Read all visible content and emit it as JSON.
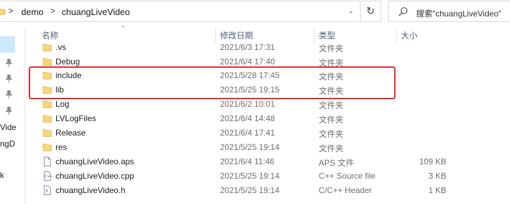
{
  "breadcrumb": {
    "items": [
      "demo",
      "chuangLiveVideo"
    ],
    "separator": ">"
  },
  "search": {
    "placeholder": "搜索\"chuangLiveVideo\""
  },
  "icons": {
    "refresh": "refresh-icon",
    "search": "search-icon",
    "dropdown": "chevron-down-icon",
    "pin": "pin-icon",
    "folder": "folder-icon"
  },
  "nav": {
    "fragments": [
      "Vide",
      "ngD",
      "k"
    ]
  },
  "columns": {
    "name": "名称",
    "date": "修改日期",
    "type": "类型",
    "size": "大小"
  },
  "rows": [
    {
      "name": ".vs",
      "date": "2021/6/3 17:31",
      "type": "文件夹",
      "size": "",
      "icon": "folder"
    },
    {
      "name": "Debug",
      "date": "2021/6/4 17:40",
      "type": "文件夹",
      "size": "",
      "icon": "folder"
    },
    {
      "name": "include",
      "date": "2021/5/28 17:45",
      "type": "文件夹",
      "size": "",
      "icon": "folder"
    },
    {
      "name": "lib",
      "date": "2021/5/25 19:15",
      "type": "文件夹",
      "size": "",
      "icon": "folder"
    },
    {
      "name": "Log",
      "date": "2021/6/2 10:01",
      "type": "文件夹",
      "size": "",
      "icon": "folder"
    },
    {
      "name": "LVLogFiles",
      "date": "2021/6/4 14:48",
      "type": "文件夹",
      "size": "",
      "icon": "folder"
    },
    {
      "name": "Release",
      "date": "2021/6/4 17:41",
      "type": "文件夹",
      "size": "",
      "icon": "folder"
    },
    {
      "name": "res",
      "date": "2021/5/25 19:14",
      "type": "文件夹",
      "size": "",
      "icon": "folder"
    },
    {
      "name": "chuangLiveVideo.aps",
      "date": "2021/6/4 11:46",
      "type": "APS 文件",
      "size": "109 KB",
      "icon": "file"
    },
    {
      "name": "chuangLiveVideo.cpp",
      "date": "2021/5/25 19:14",
      "type": "C++ Source file",
      "size": "3 KB",
      "icon": "cpp"
    },
    {
      "name": "chuangLiveVideo.h",
      "date": "2021/5/25 19:14",
      "type": "C/C++ Header",
      "size": "1 KB",
      "icon": "h"
    }
  ],
  "colors": {
    "highlight": "#e8252a",
    "selection": "#cce8ff",
    "folder": "#f8d775",
    "header_text": "#4c607a"
  }
}
